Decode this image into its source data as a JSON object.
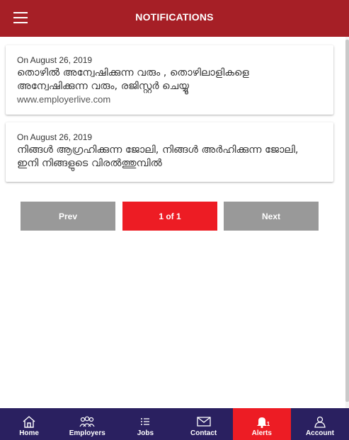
{
  "header": {
    "title": "NOTIFICATIONS"
  },
  "notifications": [
    {
      "date": "On August 26, 2019",
      "message": "തൊഴിൽ അന്വേഷിക്കുന്ന വരും , തൊഴിലാളികളെ അന്വേഷിക്കുന്ന വരും, രജിസ്റ്റർ ചെയ്യൂ",
      "link": "www.employerlive.com"
    },
    {
      "date": "On August 26, 2019",
      "message": "നിങ്ങൾ ആഗ്രഹിക്കുന്ന ജോലി, നിങ്ങൾ അർഹിക്കുന്ന ജോലി, ഇനി നിങ്ങളുടെ വിരൽത്തുമ്പിൽ",
      "link": ""
    }
  ],
  "pager": {
    "prev": "Prev",
    "current": "1 of 1",
    "next": "Next"
  },
  "nav": {
    "items": [
      {
        "label": "Home",
        "icon": "home-icon"
      },
      {
        "label": "Employers",
        "icon": "people-icon"
      },
      {
        "label": "Jobs",
        "icon": "list-icon"
      },
      {
        "label": "Contact",
        "icon": "envelope-icon"
      },
      {
        "label": "Alerts",
        "icon": "bell-icon",
        "badge": "1"
      },
      {
        "label": "Account",
        "icon": "user-icon"
      }
    ]
  },
  "colors": {
    "header": "#a61f26",
    "accent": "#ed1c24",
    "pager_gray": "#999999",
    "nav_bg": "#2a2060"
  }
}
